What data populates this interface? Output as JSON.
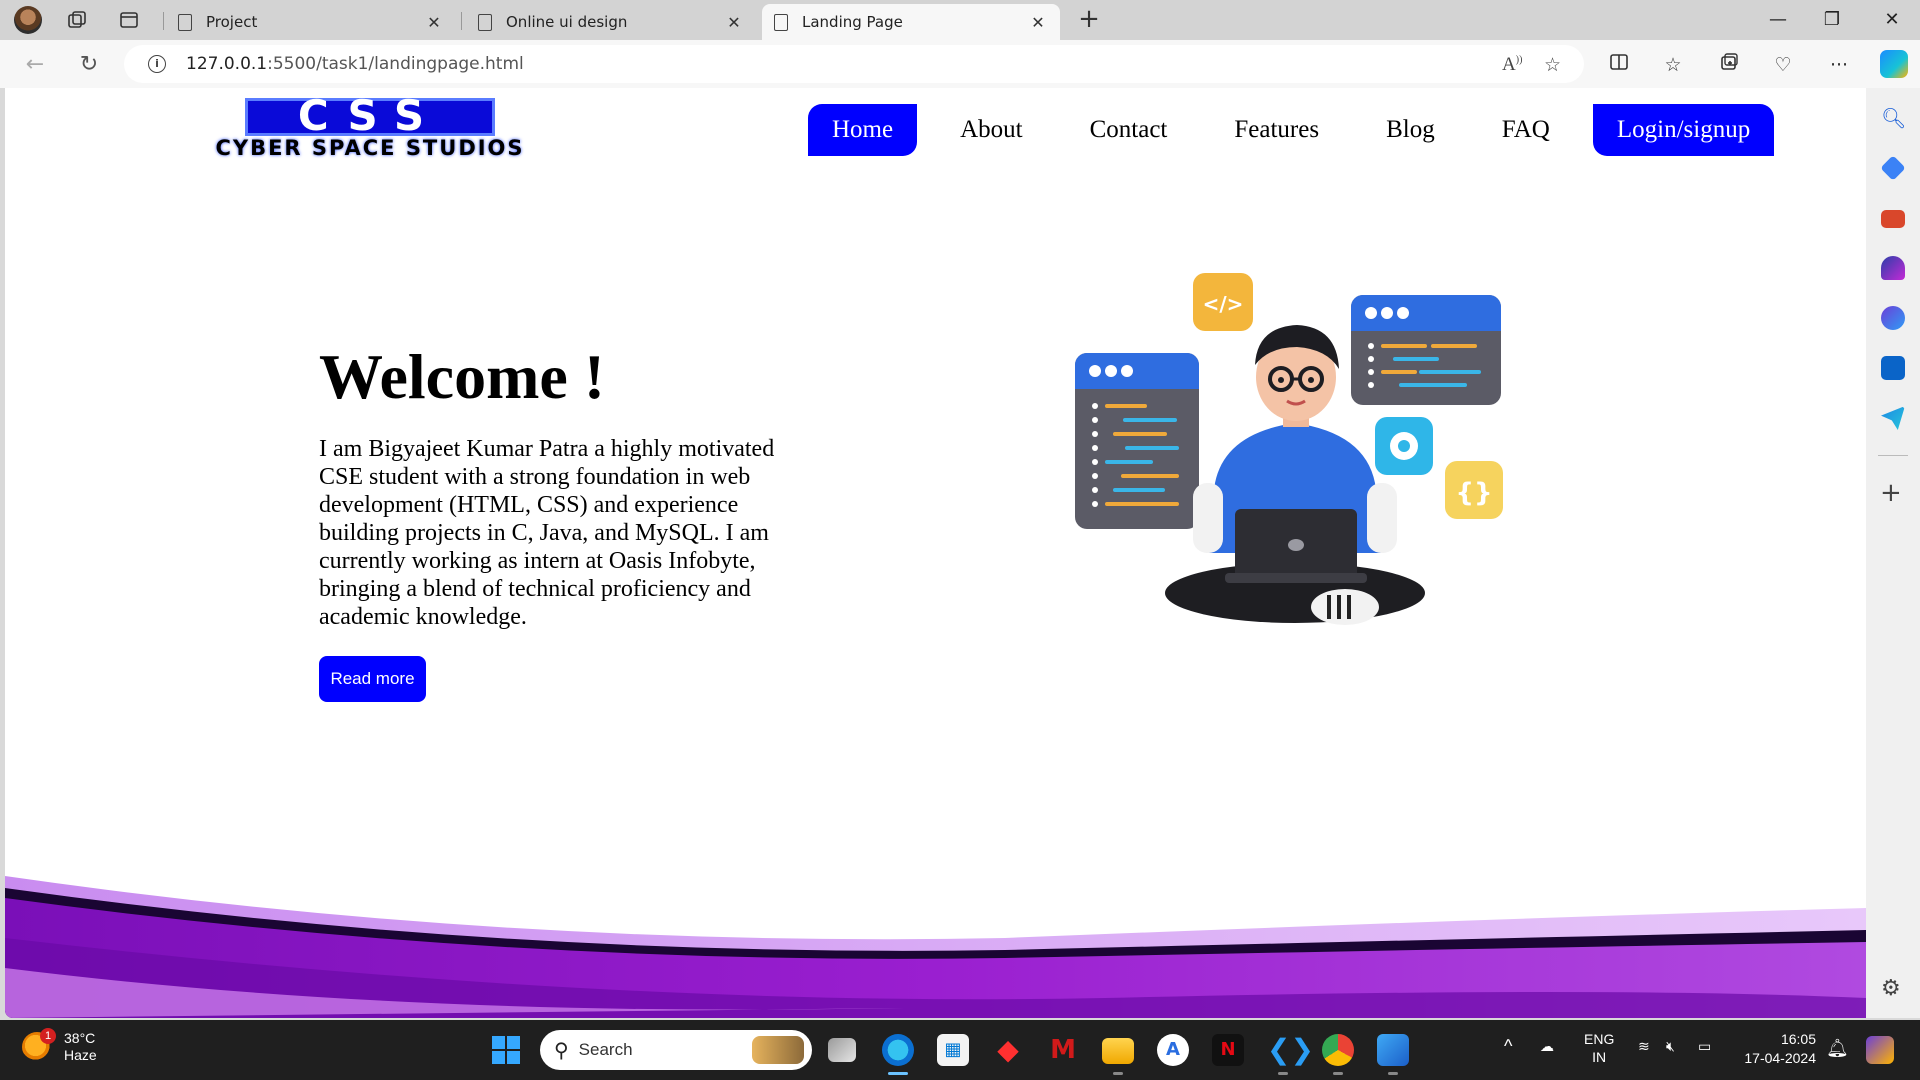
{
  "browser": {
    "tabs": [
      {
        "label": "Project",
        "active": false
      },
      {
        "label": "Online ui design",
        "active": false
      },
      {
        "label": "Landing Page",
        "active": true
      }
    ],
    "url_host": "127.0.0.1",
    "url_rest": ":5500/task1/landingpage.html"
  },
  "site": {
    "logo_top": "CSS",
    "logo_bottom": "CYBER SPACE STUDIOS",
    "nav": [
      "Home",
      "About",
      "Contact",
      "Features",
      "Blog",
      "FAQ",
      "Login/signup"
    ],
    "active_nav": "Home",
    "accent_color": "#0000ff",
    "hero": {
      "title": "Welcome !",
      "text": "I am Bigyajeet Kumar Patra a highly motivated CSE student with a strong foundation in web development (HTML, CSS) and experience building projects in C, Java, and MySQL. I am currently working as intern at Oasis Infobyte, bringing a blend of technical proficiency and academic knowledge.",
      "button": "Read more"
    }
  },
  "taskbar": {
    "weather_temp": "38°C",
    "weather_desc": "Haze",
    "notification_count": "1",
    "search_label": "Search",
    "lang_top": "ENG",
    "lang_bottom": "IN",
    "time": "16:05",
    "date": "17-04-2024"
  }
}
